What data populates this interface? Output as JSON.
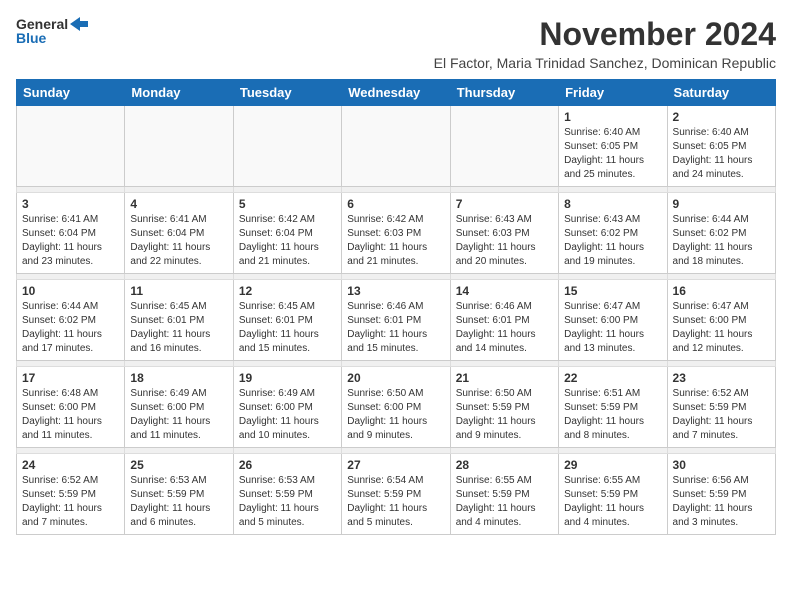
{
  "logo": {
    "line1": "General",
    "line2": "Blue"
  },
  "title": "November 2024",
  "subtitle": "El Factor, Maria Trinidad Sanchez, Dominican Republic",
  "weekdays": [
    "Sunday",
    "Monday",
    "Tuesday",
    "Wednesday",
    "Thursday",
    "Friday",
    "Saturday"
  ],
  "weeks": [
    [
      {
        "day": "",
        "info": ""
      },
      {
        "day": "",
        "info": ""
      },
      {
        "day": "",
        "info": ""
      },
      {
        "day": "",
        "info": ""
      },
      {
        "day": "",
        "info": ""
      },
      {
        "day": "1",
        "info": "Sunrise: 6:40 AM\nSunset: 6:05 PM\nDaylight: 11 hours\nand 25 minutes."
      },
      {
        "day": "2",
        "info": "Sunrise: 6:40 AM\nSunset: 6:05 PM\nDaylight: 11 hours\nand 24 minutes."
      }
    ],
    [
      {
        "day": "3",
        "info": "Sunrise: 6:41 AM\nSunset: 6:04 PM\nDaylight: 11 hours\nand 23 minutes."
      },
      {
        "day": "4",
        "info": "Sunrise: 6:41 AM\nSunset: 6:04 PM\nDaylight: 11 hours\nand 22 minutes."
      },
      {
        "day": "5",
        "info": "Sunrise: 6:42 AM\nSunset: 6:04 PM\nDaylight: 11 hours\nand 21 minutes."
      },
      {
        "day": "6",
        "info": "Sunrise: 6:42 AM\nSunset: 6:03 PM\nDaylight: 11 hours\nand 21 minutes."
      },
      {
        "day": "7",
        "info": "Sunrise: 6:43 AM\nSunset: 6:03 PM\nDaylight: 11 hours\nand 20 minutes."
      },
      {
        "day": "8",
        "info": "Sunrise: 6:43 AM\nSunset: 6:02 PM\nDaylight: 11 hours\nand 19 minutes."
      },
      {
        "day": "9",
        "info": "Sunrise: 6:44 AM\nSunset: 6:02 PM\nDaylight: 11 hours\nand 18 minutes."
      }
    ],
    [
      {
        "day": "10",
        "info": "Sunrise: 6:44 AM\nSunset: 6:02 PM\nDaylight: 11 hours\nand 17 minutes."
      },
      {
        "day": "11",
        "info": "Sunrise: 6:45 AM\nSunset: 6:01 PM\nDaylight: 11 hours\nand 16 minutes."
      },
      {
        "day": "12",
        "info": "Sunrise: 6:45 AM\nSunset: 6:01 PM\nDaylight: 11 hours\nand 15 minutes."
      },
      {
        "day": "13",
        "info": "Sunrise: 6:46 AM\nSunset: 6:01 PM\nDaylight: 11 hours\nand 15 minutes."
      },
      {
        "day": "14",
        "info": "Sunrise: 6:46 AM\nSunset: 6:01 PM\nDaylight: 11 hours\nand 14 minutes."
      },
      {
        "day": "15",
        "info": "Sunrise: 6:47 AM\nSunset: 6:00 PM\nDaylight: 11 hours\nand 13 minutes."
      },
      {
        "day": "16",
        "info": "Sunrise: 6:47 AM\nSunset: 6:00 PM\nDaylight: 11 hours\nand 12 minutes."
      }
    ],
    [
      {
        "day": "17",
        "info": "Sunrise: 6:48 AM\nSunset: 6:00 PM\nDaylight: 11 hours\nand 11 minutes."
      },
      {
        "day": "18",
        "info": "Sunrise: 6:49 AM\nSunset: 6:00 PM\nDaylight: 11 hours\nand 11 minutes."
      },
      {
        "day": "19",
        "info": "Sunrise: 6:49 AM\nSunset: 6:00 PM\nDaylight: 11 hours\nand 10 minutes."
      },
      {
        "day": "20",
        "info": "Sunrise: 6:50 AM\nSunset: 6:00 PM\nDaylight: 11 hours\nand 9 minutes."
      },
      {
        "day": "21",
        "info": "Sunrise: 6:50 AM\nSunset: 5:59 PM\nDaylight: 11 hours\nand 9 minutes."
      },
      {
        "day": "22",
        "info": "Sunrise: 6:51 AM\nSunset: 5:59 PM\nDaylight: 11 hours\nand 8 minutes."
      },
      {
        "day": "23",
        "info": "Sunrise: 6:52 AM\nSunset: 5:59 PM\nDaylight: 11 hours\nand 7 minutes."
      }
    ],
    [
      {
        "day": "24",
        "info": "Sunrise: 6:52 AM\nSunset: 5:59 PM\nDaylight: 11 hours\nand 7 minutes."
      },
      {
        "day": "25",
        "info": "Sunrise: 6:53 AM\nSunset: 5:59 PM\nDaylight: 11 hours\nand 6 minutes."
      },
      {
        "day": "26",
        "info": "Sunrise: 6:53 AM\nSunset: 5:59 PM\nDaylight: 11 hours\nand 5 minutes."
      },
      {
        "day": "27",
        "info": "Sunrise: 6:54 AM\nSunset: 5:59 PM\nDaylight: 11 hours\nand 5 minutes."
      },
      {
        "day": "28",
        "info": "Sunrise: 6:55 AM\nSunset: 5:59 PM\nDaylight: 11 hours\nand 4 minutes."
      },
      {
        "day": "29",
        "info": "Sunrise: 6:55 AM\nSunset: 5:59 PM\nDaylight: 11 hours\nand 4 minutes."
      },
      {
        "day": "30",
        "info": "Sunrise: 6:56 AM\nSunset: 5:59 PM\nDaylight: 11 hours\nand 3 minutes."
      }
    ]
  ]
}
